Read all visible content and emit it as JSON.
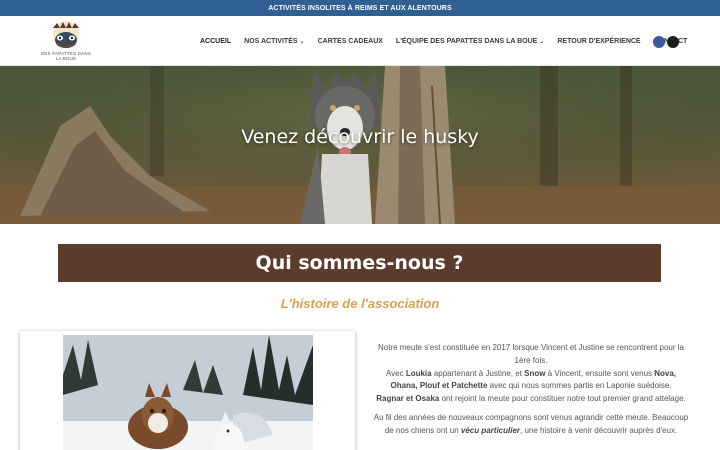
{
  "topbar": {
    "text": "ACTIVITÉS INSOLITES À REIMS ET AUX ALENTOURS"
  },
  "logo": {
    "line1": "DES PAPATTES DANS",
    "line2": "LA BOUE"
  },
  "nav": {
    "items": [
      {
        "label": "ACCUEIL",
        "dropdown": false
      },
      {
        "label": "NOS ACTIVITÉS",
        "dropdown": true
      },
      {
        "label": "CARTES CADEAUX",
        "dropdown": false
      },
      {
        "label": "L'ÉQUIPE DES PAPATTES DANS LA BOUE",
        "dropdown": true
      },
      {
        "label": "RETOUR D'EXPÉRIENCE",
        "dropdown": false
      },
      {
        "label": "CONTACT",
        "dropdown": false
      }
    ],
    "chevron": "⌄"
  },
  "hero": {
    "title": "Venez découvrir le husky"
  },
  "section": {
    "title": "Qui sommes-nous ?",
    "subtitle": "L'histoire de l'association"
  },
  "about": {
    "p1_a": "Notre meute s'est constituée en 2017 lorsque Vincent et Justine se rencontrent pour la 1ère fois.",
    "p1_b1": "Avec ",
    "p1_b2": "Loukia",
    "p1_b3": " appartenant à Justine, et ",
    "p1_b4": "Snow",
    "p1_b5": " à Vincent, ensuite sont venus ",
    "p1_b6": "Nova, Ohana, Plouf et Patchette",
    "p1_b7": " avec qui nous sommes partis en Laponie suédoise.",
    "p1_c1": "Ragnar et Osaka",
    "p1_c2": " ont rejoint la meute pour constituer notre tout premier grand attelage.",
    "p2_a": "Au fil des années de nouveaux compagnons sont venus agrandir cette meute. Beaucoup de nos chiens ont un ",
    "p2_b": "vécu particulier",
    "p2_c": ", une histoire à venir découvrir auprès d'eux."
  },
  "colors": {
    "topbar": "#2f5f93",
    "section_band": "#5a3b2c",
    "subtitle": "#d9a04c",
    "facebook": "#3b5998"
  },
  "icons": [
    "facebook-icon",
    "instagram-icon",
    "chevron-down-icon"
  ]
}
